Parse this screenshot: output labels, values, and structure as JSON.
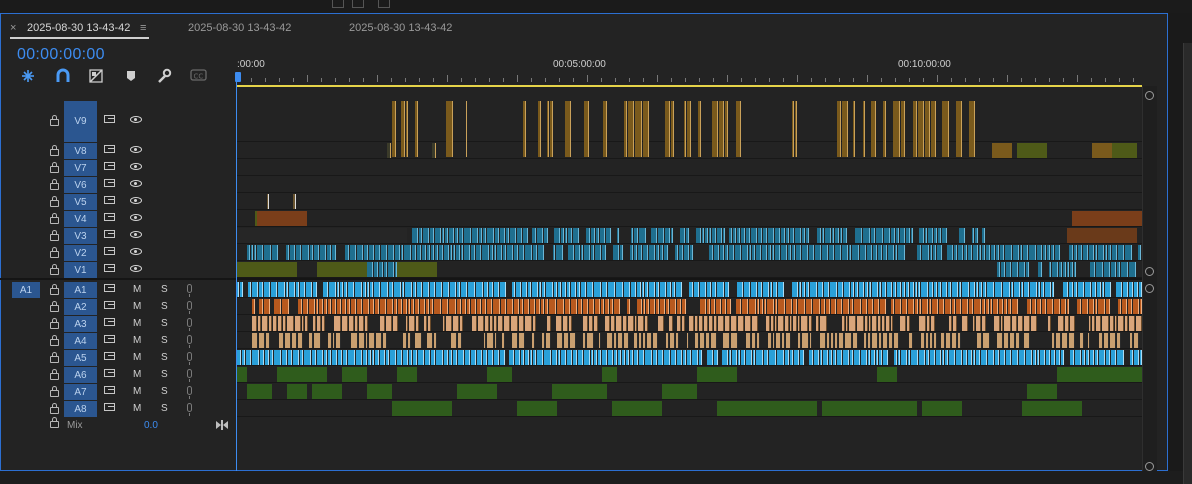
{
  "tabs": [
    {
      "label": "2025-08-30 13-43-42",
      "active": true
    },
    {
      "label": "2025-08-30 13-43-42",
      "active": false
    },
    {
      "label": "2025-08-30 13-43-42",
      "active": false
    }
  ],
  "tab_close": "×",
  "tab_menu": "≡",
  "timecode": "00:00:00:00",
  "ruler_labels": [
    ":00:00",
    "00:05:00:00",
    "00:10:00:00"
  ],
  "video_tracks": [
    "V9",
    "V8",
    "V7",
    "V6",
    "V5",
    "V4",
    "V3",
    "V2",
    "V1"
  ],
  "audio_tracks": [
    "A1",
    "A2",
    "A3",
    "A4",
    "A5",
    "A6",
    "A7",
    "A8"
  ],
  "source_patch": "A1",
  "mute_label": "M",
  "solo_label": "S",
  "mix": {
    "label": "Mix",
    "value": "0.0"
  },
  "colors": {
    "accent": "#3d8cf0",
    "track_label_bg": "#2b5690",
    "video_clip_brown": "#7a5a1c",
    "video_clip_green": "#4e5a18",
    "video_clip_blue": "#1f6f8f",
    "audio_clip_blue": "#2aa0d8",
    "audio_clip_orange": "#b8591e",
    "audio_clip_peach": "#d9a57a",
    "audio_clip_green": "#2f5c1c",
    "work_area": "#e6d44a"
  },
  "icons": [
    "snap-icon",
    "linked-selection-icon",
    "add-marker-icon",
    "marker-icon",
    "wrench-icon",
    "captions-icon"
  ]
}
